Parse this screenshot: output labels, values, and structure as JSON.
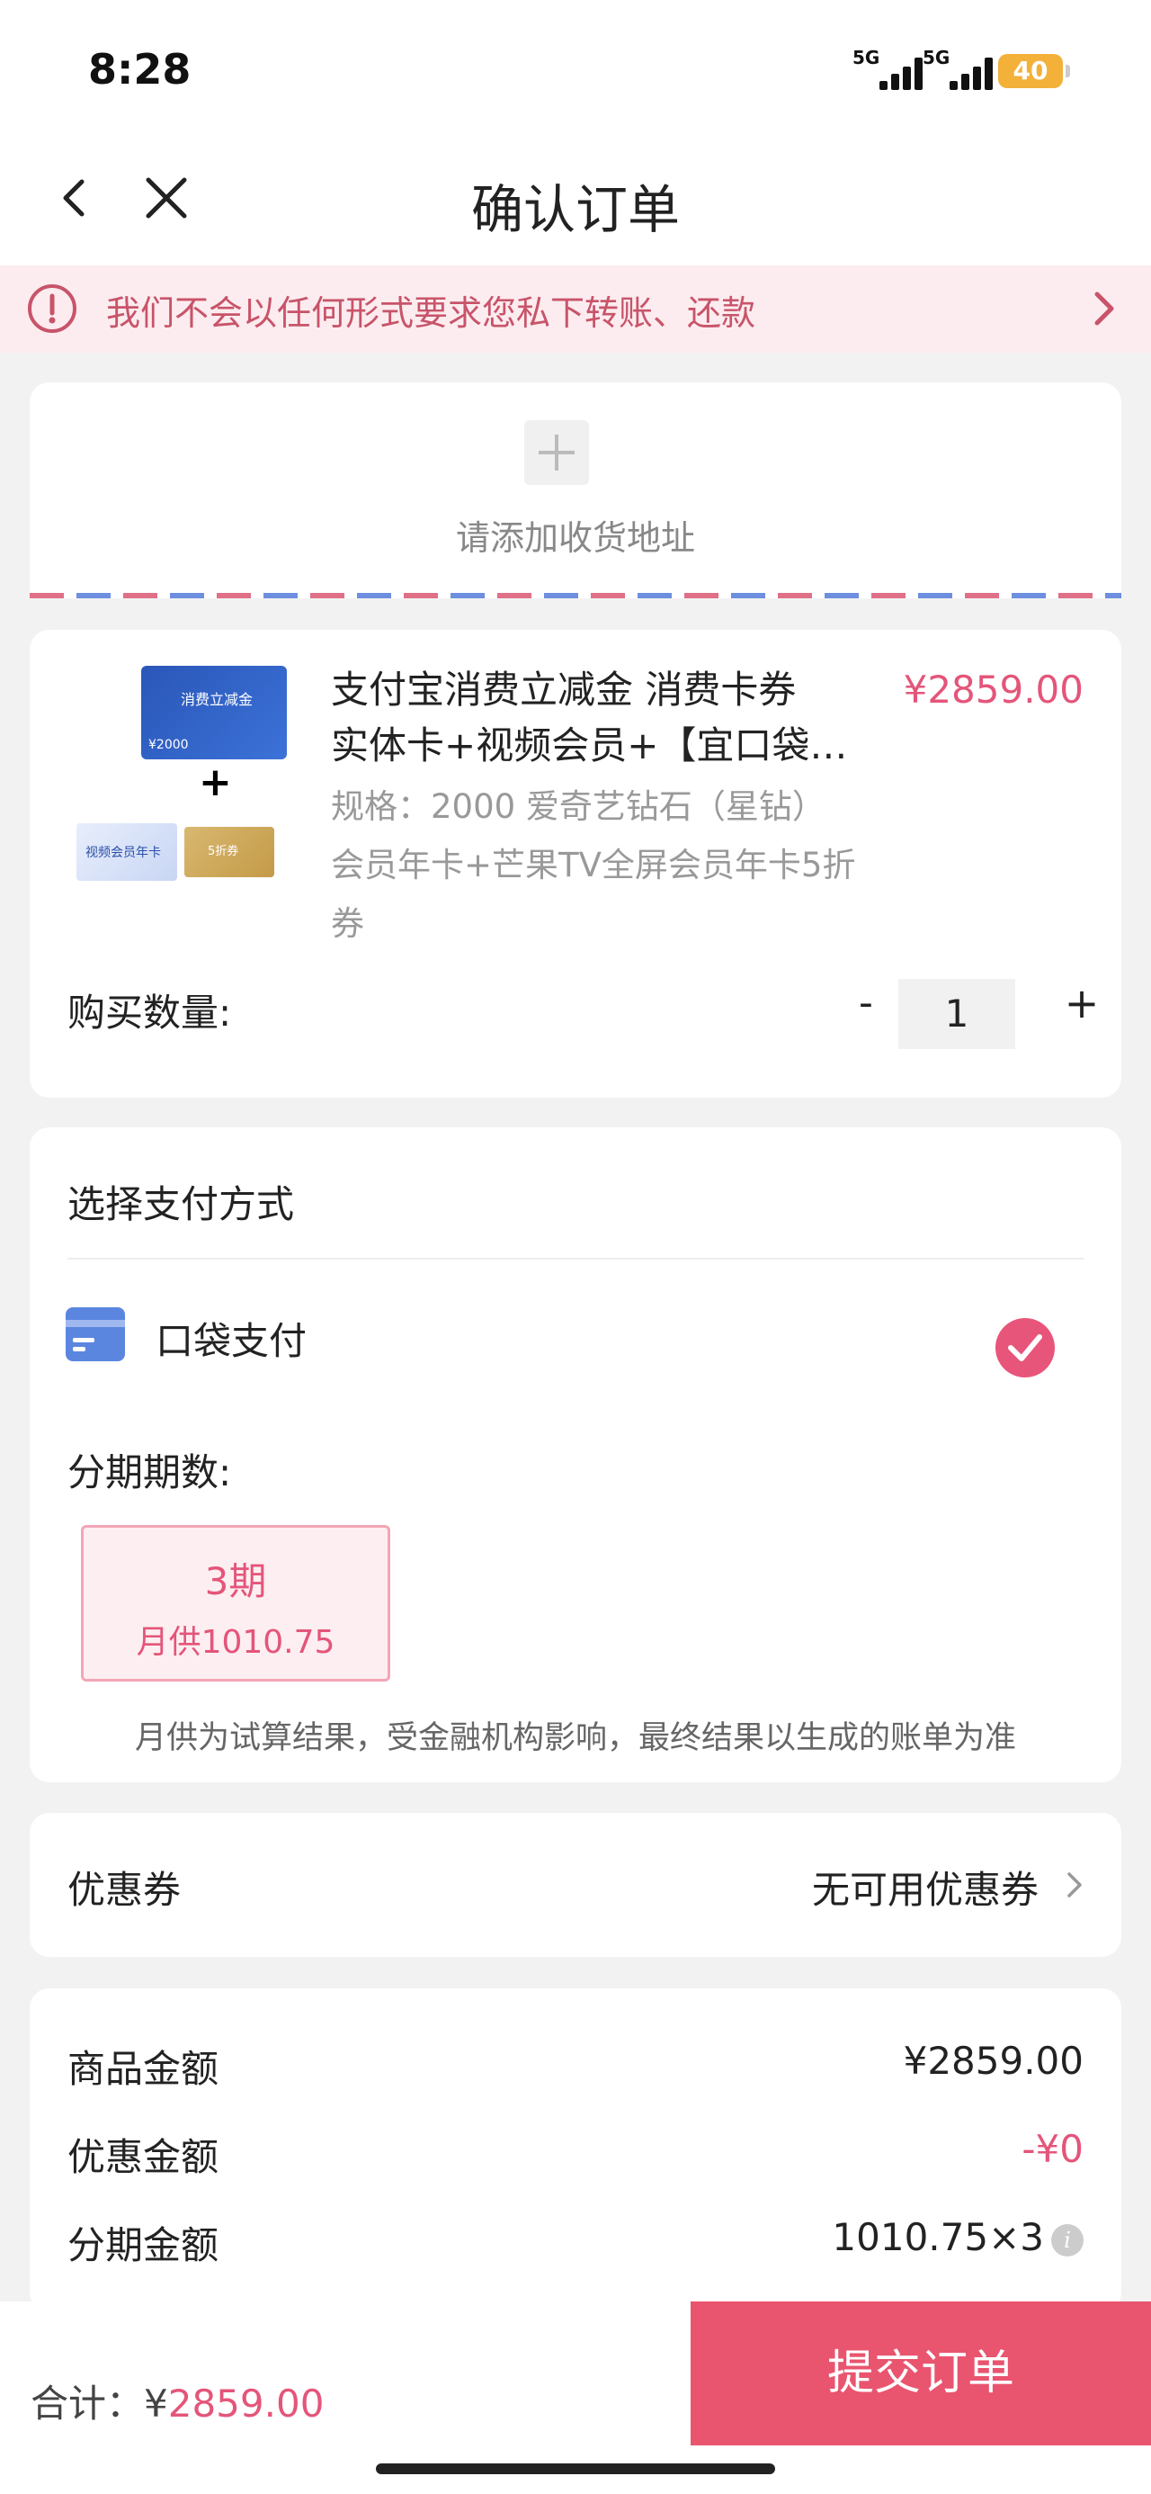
{
  "status": {
    "time": "8:28",
    "signal1": "5G",
    "signal2": "5G",
    "battery": "40"
  },
  "nav": {
    "title": "确认订单"
  },
  "notice": {
    "text": "我们不会以任何形式要求您私下转账、还款"
  },
  "address": {
    "placeholder": "请添加收货地址"
  },
  "product": {
    "title_line1": "支付宝消费立减金 消费卡券",
    "title_line2": "实体卡+视频会员+【宜口袋…",
    "price": "¥2859.00",
    "spec_line1": "规格：2000 爱奇艺钻石（星钻）",
    "spec_line2": "会员年卡+芒果TV全屏会员年卡5折",
    "spec_line3": "券",
    "image": {
      "card_title": "消费立减金",
      "card_value": "¥2000",
      "plus": "+",
      "member_card": "视频会员年卡",
      "coupon": "5折券"
    },
    "qty_label": "购买数量:",
    "qty_minus": "-",
    "qty_value": "1",
    "qty_plus": "+"
  },
  "payment": {
    "title": "选择支付方式",
    "method": "口袋支付",
    "installment_label": "分期期数:",
    "option_term": "3期",
    "option_monthly": "月供1010.75",
    "note": "月供为试算结果，受金融机构影响，最终结果以生成的账单为准"
  },
  "coupon": {
    "label": "优惠券",
    "value": "无可用优惠券"
  },
  "summary": {
    "goods_label": "商品金额",
    "goods_value": "¥2859.00",
    "discount_label": "优惠金额",
    "discount_value": "-¥0",
    "installment_label": "分期金额",
    "installment_value": "1010.75×3"
  },
  "bottom": {
    "total_label": "合计：¥",
    "total_amount": "2859.00",
    "submit": "提交订单"
  },
  "colors": {
    "accent": "#e9546f",
    "price": "#e4557a",
    "notice_bg": "#fcecef"
  }
}
